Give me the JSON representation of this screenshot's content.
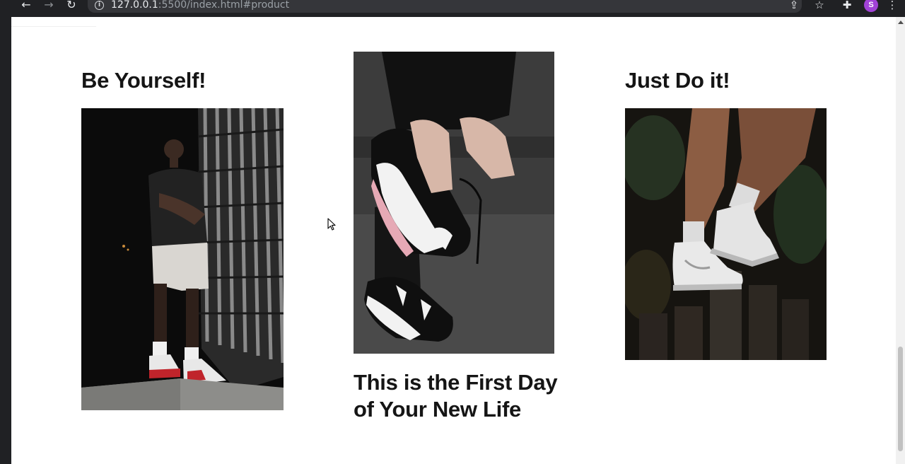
{
  "browser": {
    "url_host": "127.0.0.1",
    "url_rest": ":5500/index.html#product",
    "profile_initial": "S"
  },
  "products": [
    {
      "title": "Be Yourself!"
    },
    {
      "title": "This is the First Day of Your New Life"
    },
    {
      "title": "Just Do it!"
    }
  ]
}
